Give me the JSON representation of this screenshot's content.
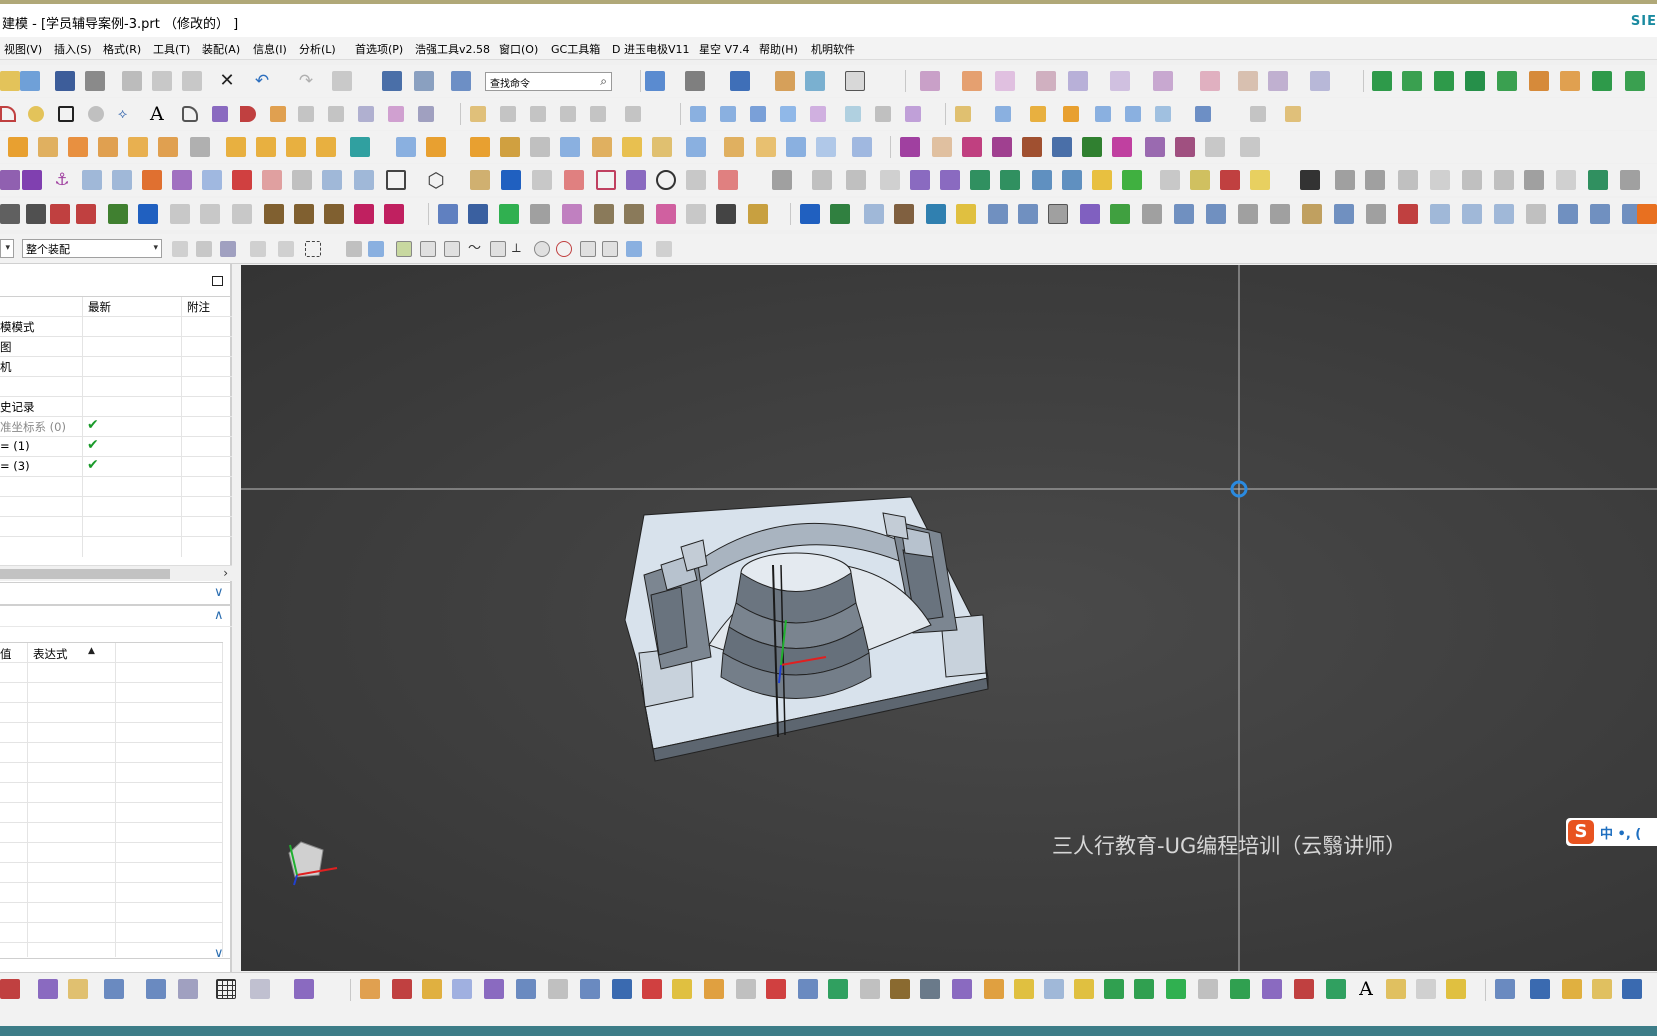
{
  "window": {
    "title": "建模 - [学员辅导案例-3.prt （修改的） ]",
    "brand": "SIE"
  },
  "menubar": {
    "items": [
      "视图(V)",
      "插入(S)",
      "格式(R)",
      "工具(T)",
      "装配(A)",
      "信息(I)",
      "分析(L)",
      "首选项(P)",
      "浩强工具v2.58",
      "窗口(O)",
      "GC工具箱",
      "D 进玉电极V11",
      "星空 V7.4",
      "帮助(H)",
      "机明软件"
    ]
  },
  "toolbar": {
    "search_placeholder": "查找命令"
  },
  "selection_bar": {
    "scope_value": "整个装配"
  },
  "part_navigator": {
    "columns": [
      "最新",
      "附注"
    ],
    "rows": [
      {
        "label": "模模式",
        "check": false,
        "dim": false
      },
      {
        "label": "图",
        "check": false,
        "dim": false
      },
      {
        "label": "机",
        "check": false,
        "dim": false
      },
      {
        "label": "",
        "check": false,
        "dim": false
      },
      {
        "label": "史记录",
        "check": false,
        "dim": false
      },
      {
        "label": "准坐标系 (0)",
        "check": true,
        "dim": true
      },
      {
        "label": "= (1)",
        "check": true,
        "dim": false
      },
      {
        "label": "= (3)",
        "check": true,
        "dim": false
      }
    ],
    "check_glyph": "✔",
    "details_columns": [
      "值",
      "表达式"
    ]
  },
  "viewport": {
    "watermark": "三人行教育-UG编程培训（云翳讲师）",
    "background_color": "#3e3e3e"
  },
  "ime": {
    "logo": "S",
    "text": "中 •, ("
  },
  "colors": {
    "accent_green": "#1a9a2a",
    "ime_orange": "#e8531f",
    "status_teal": "#3d7d88",
    "brand_teal": "#1a8aa0"
  }
}
